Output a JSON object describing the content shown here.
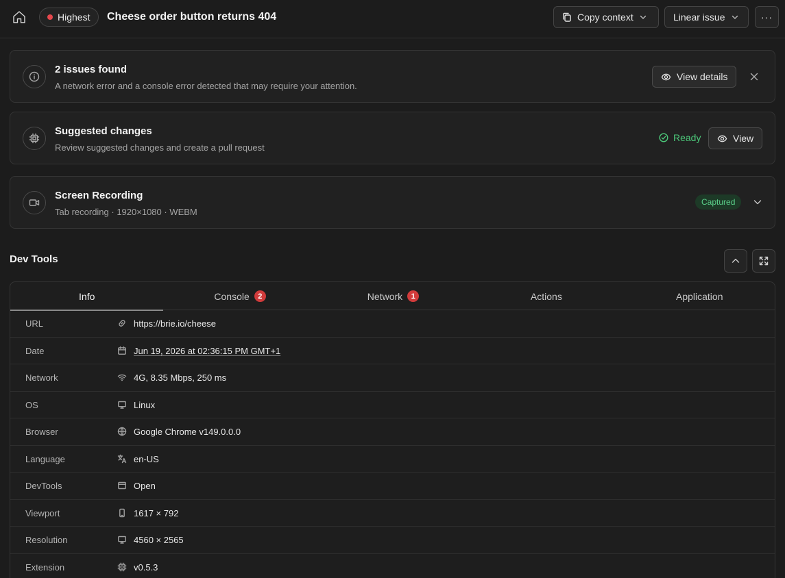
{
  "header": {
    "priority": "Highest",
    "priority_color": "#e5484d",
    "title": "Cheese order button returns 404",
    "copy_context": "Copy context",
    "linear_issue": "Linear issue",
    "more": "···"
  },
  "issues_card": {
    "title": "2 issues found",
    "subtitle": "A network error and a console error detected that may require your attention.",
    "button": "View details"
  },
  "changes_card": {
    "title": "Suggested changes",
    "subtitle": "Review suggested changes and create a pull request",
    "status": "Ready",
    "button": "View"
  },
  "recording_card": {
    "title": "Screen Recording",
    "subtitle": "Tab recording · 1920×1080 · WEBM",
    "status": "Captured"
  },
  "devtools": {
    "title": "Dev Tools",
    "tabs": [
      {
        "label": "Info",
        "badge": ""
      },
      {
        "label": "Console",
        "badge": "2"
      },
      {
        "label": "Network",
        "badge": "1"
      },
      {
        "label": "Actions",
        "badge": ""
      },
      {
        "label": "Application",
        "badge": ""
      }
    ],
    "rows": [
      {
        "label": "URL",
        "value": "https://brie.io/cheese",
        "icon": "link-icon"
      },
      {
        "label": "Date",
        "value": "Jun 19, 2026 at 02:36:15 PM GMT+1",
        "icon": "calendar-icon"
      },
      {
        "label": "Network",
        "value": "4G, 8.35 Mbps, 250 ms",
        "icon": "wifi-icon"
      },
      {
        "label": "OS",
        "value": "Linux",
        "icon": "monitor-icon"
      },
      {
        "label": "Browser",
        "value": "Google Chrome v149.0.0.0",
        "icon": "globe-icon"
      },
      {
        "label": "Language",
        "value": "en-US",
        "icon": "translate-icon"
      },
      {
        "label": "DevTools",
        "value": "Open",
        "icon": "window-icon"
      },
      {
        "label": "Viewport",
        "value": "1617 × 792",
        "icon": "phone-icon"
      },
      {
        "label": "Resolution",
        "value": "4560 × 2565",
        "icon": "monitor-icon"
      },
      {
        "label": "Extension",
        "value": "v0.5.3",
        "icon": "chip-icon"
      }
    ]
  }
}
